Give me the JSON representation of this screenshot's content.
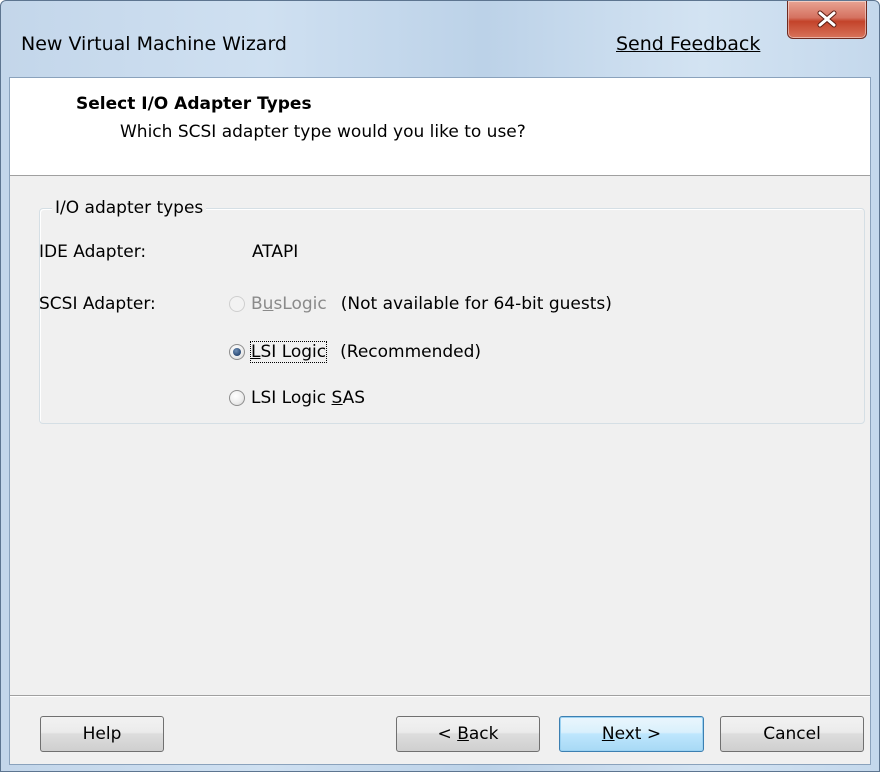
{
  "window": {
    "title": "New Virtual Machine Wizard",
    "feedback_link": "Send Feedback",
    "close_icon": "close-x-icon"
  },
  "header": {
    "title": "Select I/O Adapter Types",
    "subtitle": "Which SCSI adapter type would you like to use?"
  },
  "group": {
    "legend": "I/O adapter types",
    "ide_label": "IDE Adapter:",
    "ide_value": "ATAPI",
    "scsi_label": "SCSI Adapter:",
    "options": [
      {
        "pre": "B",
        "accel": "u",
        "post": "sLogic",
        "note": "(Not available for 64-bit guests)",
        "checked": false,
        "disabled": true
      },
      {
        "pre": "",
        "accel": "L",
        "post": "SI Logic",
        "note": "(Recommended)",
        "checked": true,
        "disabled": false
      },
      {
        "pre": "LSI Logic ",
        "accel": "S",
        "post": "AS",
        "note": "",
        "checked": false,
        "disabled": false
      }
    ]
  },
  "buttons": {
    "help": "Help",
    "back": {
      "pre": "< ",
      "accel": "B",
      "post": "ack"
    },
    "next": {
      "pre": "",
      "accel": "N",
      "post": "ext >"
    },
    "cancel": "Cancel"
  },
  "colors": {
    "title_bar": "#c8dbef",
    "close_button": "#c9503a",
    "dialog_bg": "#f0f0f0",
    "header_bg": "#ffffff",
    "default_button_border": "#3c7fb1"
  }
}
